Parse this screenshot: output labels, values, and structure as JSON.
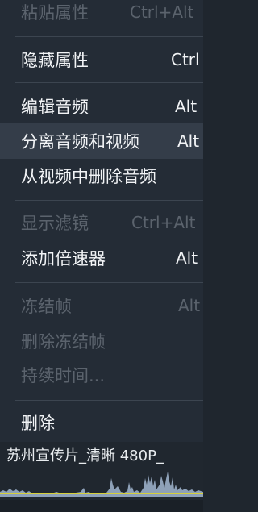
{
  "menu": {
    "paste_attributes": {
      "label": "粘贴属性",
      "shortcut": "Ctrl+Alt"
    },
    "hide_attributes": {
      "label": "隐藏属性",
      "shortcut": "Ctrl"
    },
    "edit_audio": {
      "label": "编辑音频",
      "shortcut": "Alt"
    },
    "separate_audio_video": {
      "label": "分离音频和视频",
      "shortcut": "Alt"
    },
    "remove_audio": {
      "label": "从视频中删除音频"
    },
    "show_filters": {
      "label": "显示滤镜",
      "shortcut": "Ctrl+Alt"
    },
    "add_speed": {
      "label": "添加倍速器",
      "shortcut": "Alt"
    },
    "freeze_frame": {
      "label": "冻结帧",
      "shortcut": "Alt"
    },
    "delete_freeze_frame": {
      "label": "删除冻结帧"
    },
    "duration": {
      "label": "持续时间..."
    },
    "delete": {
      "label": "删除"
    }
  },
  "timeline": {
    "clip_title": "苏州宣传片_清晰 480P_"
  },
  "colors": {
    "menu_bg": "#242c36",
    "highlight_bg": "#343d49",
    "disabled_text": "#5b636d",
    "waveform": "#8ea1b8",
    "playhead_line": "#d6cf3a"
  }
}
